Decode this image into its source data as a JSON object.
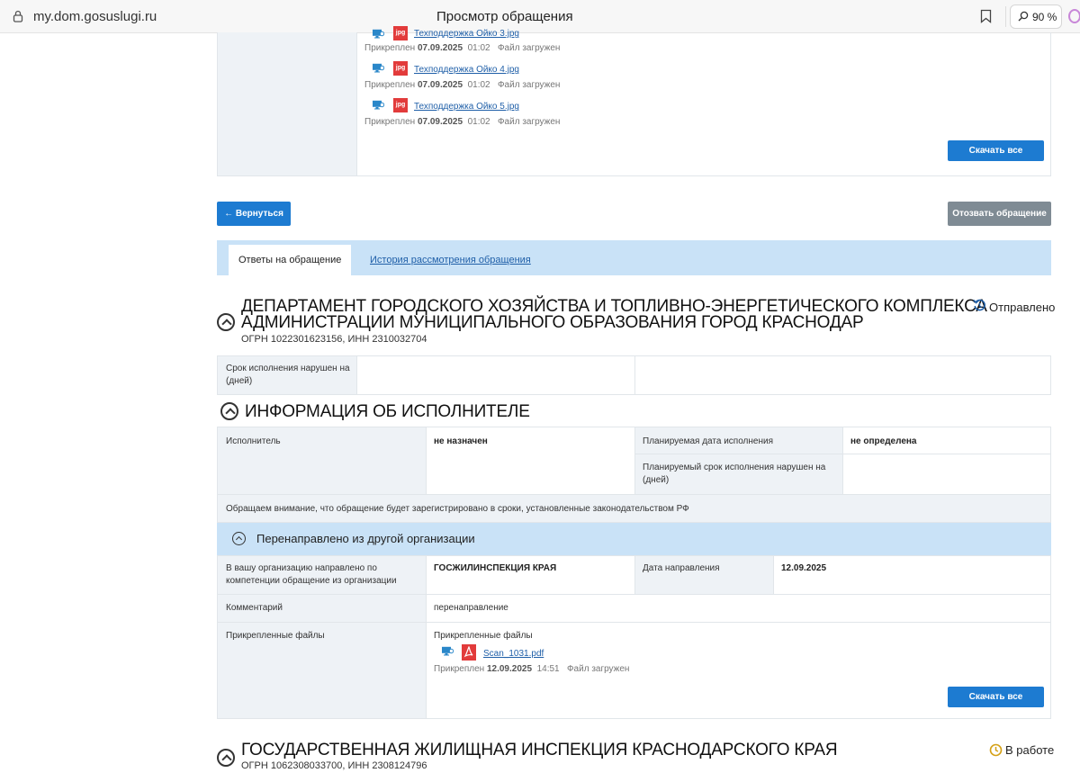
{
  "browser": {
    "url": "my.dom.gosuslugi.ru",
    "title": "Просмотр обращения",
    "zoom": "90 %"
  },
  "top_files": {
    "items": [
      {
        "name": "Техподдержка Ойко 3.jpg",
        "attached_label": "Прикреплен",
        "date": "07.09.2025",
        "time": "01:02",
        "status": "Файл загружен"
      },
      {
        "name": "Техподдержка Ойко 4.jpg",
        "attached_label": "Прикреплен",
        "date": "07.09.2025",
        "time": "01:02",
        "status": "Файл загружен"
      },
      {
        "name": "Техподдержка Ойко 5.jpg",
        "attached_label": "Прикреплен",
        "date": "07.09.2025",
        "time": "01:02",
        "status": "Файл загружен"
      }
    ],
    "file_type_label": "jpg",
    "download_all": "Скачать все"
  },
  "actions": {
    "back": "← Вернуться",
    "withdraw": "Отозвать обращение"
  },
  "tabs": {
    "answers": "Ответы на обращение",
    "history": "История рассмотрения обращения"
  },
  "org1": {
    "name_line1": "ДЕПАРТАМЕНТ ГОРОДСКОГО ХОЗЯЙСТВА И ТОПЛИВНО-ЭНЕРГЕТИЧЕСКОГО КОМПЛЕКСА",
    "name_line2": "АДМИНИСТРАЦИИ МУНИЦИПАЛЬНОГО ОБРАЗОВАНИЯ ГОРОД КРАСНОДАР",
    "ids": "ОГРН 1022301623156, ИНН 2310032704",
    "status": "Отправлено",
    "deadline_label": "Срок исполнения нарушен на (дней)"
  },
  "executor": {
    "title": "ИНФОРМАЦИЯ ОБ ИСПОЛНИТЕЛЕ",
    "executor_label": "Исполнитель",
    "executor_value": "не назначен",
    "planned_date_label": "Планируемая дата исполнения",
    "planned_date_value": "не определена",
    "planned_overdue_label": "Планируемый срок исполнения нарушен на (дней)",
    "notice": "Обращаем внимание, что обращение будет зарегистрировано в сроки, установленные законодательством РФ"
  },
  "redirect": {
    "title": "Перенаправлено из другой организации",
    "from_label": "В вашу организацию направлено по компетенции обращение из организации",
    "from_value": "ГОСЖИЛИНСПЕКЦИЯ КРАЯ",
    "date_label": "Дата направления",
    "date_value": "12.09.2025",
    "comment_label": "Комментарий",
    "comment_value": "перенаправление",
    "files_label": "Прикрепленные файлы",
    "files_heading": "Прикрепленные файлы",
    "file_name": "Scan_1031.pdf",
    "file_attached_label": "Прикреплен",
    "file_date": "12.09.2025",
    "file_time": "14:51",
    "file_status": "Файл загружен",
    "download_all": "Скачать все"
  },
  "org2": {
    "name": "ГОСУДАРСТВЕННАЯ ЖИЛИЩНАЯ ИНСПЕКЦИЯ КРАСНОДАРСКОГО КРАЯ",
    "ids": "ОГРН 1062308033700, ИНН 2308124796",
    "status": "В работе"
  },
  "colors": {
    "accent": "#1d7bd1",
    "tab_bar": "#c9e2f7",
    "status_sent": "#1f5fa8",
    "status_work": "#d4a015"
  }
}
